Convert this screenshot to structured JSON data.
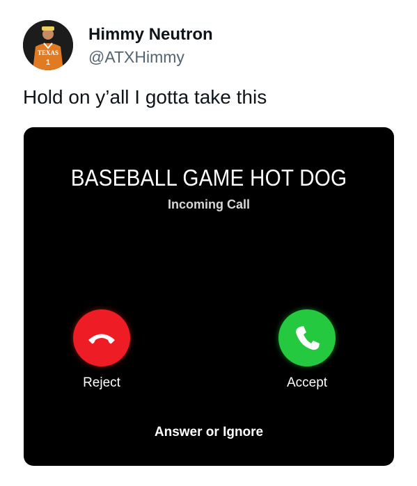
{
  "tweet": {
    "author": {
      "display_name": "Himmy Neutron",
      "handle": "@ATXHimmy",
      "avatar_icon": "avatar-photo-icon",
      "avatar_jersey_text": "TEXAS"
    },
    "text": "Hold on y’all I gotta take this"
  },
  "call_screen": {
    "caller_name": "BASEBALL GAME HOT DOG",
    "status": "Incoming Call",
    "reject": {
      "label": "Reject",
      "icon": "phone-hangup-icon",
      "color": "#ee1c24"
    },
    "accept": {
      "label": "Accept",
      "icon": "phone-icon",
      "color": "#25c93f"
    },
    "hint": "Answer or Ignore",
    "background": "#000000"
  }
}
